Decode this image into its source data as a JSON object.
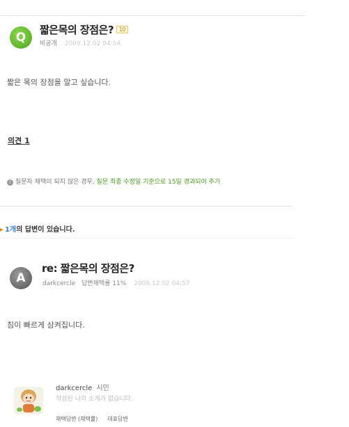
{
  "question": {
    "badge": "Q",
    "title": "짧은목의 장점은?",
    "count_badge": "10",
    "author": "비공개",
    "date": "2009.12.02 04:54",
    "body": "짧은 목의 장점을 알고 싶습니다."
  },
  "opinion_label": "의견 1",
  "notice": {
    "part1": "질문자 채택이 되지 않은 경우,",
    "part2": "질문 최종 수정일 기준으로 15일 경과되어 추가"
  },
  "answers_header": {
    "arrow": "▸",
    "count": "1개",
    "suffix": "의 답변이 있습니다."
  },
  "answer": {
    "badge": "A",
    "title": "re: 짧은목의 장점은?",
    "author": "darkcercle",
    "adoption": "답변채택률 11%",
    "date": "2009.12.02 04:57",
    "body": "침이 빠르게 삼켜집니다."
  },
  "profile": {
    "name": "darkcercle",
    "grade": "시민",
    "intro": "작성된 나의 소개가 없습니다.",
    "tab1": "채택답변 (채택률)",
    "tab2": "대표답변"
  },
  "colors": {
    "q_badge": "#5fb52c",
    "a_badge": "#777777",
    "highlight_green": "#4d9a22",
    "count_blue": "#3a7ad1"
  }
}
